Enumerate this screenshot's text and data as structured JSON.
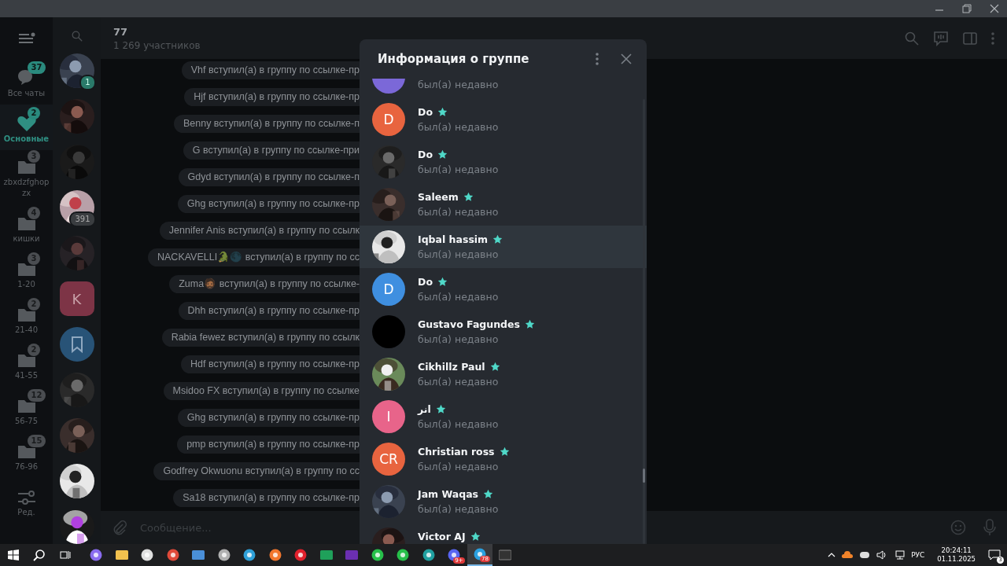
{
  "folders": [
    {
      "kind": "chats",
      "label": "Все чаты",
      "badge": "37",
      "selected": false
    },
    {
      "kind": "heart",
      "label": "Основные",
      "badge": "2",
      "selected": true
    },
    {
      "kind": "folder",
      "label": "zbxdzfghopzx",
      "badge": "3",
      "selected": false
    },
    {
      "kind": "folder",
      "label": "кишки",
      "badge": "4",
      "selected": false
    },
    {
      "kind": "folder",
      "label": "1-20",
      "badge": "3",
      "selected": false
    },
    {
      "kind": "folder",
      "label": "21-40",
      "badge": "2",
      "selected": false
    },
    {
      "kind": "folder",
      "label": "41-55",
      "badge": "2",
      "selected": false
    },
    {
      "kind": "folder",
      "label": "56-75",
      "badge": "12",
      "selected": false
    },
    {
      "kind": "folder",
      "label": "76-96",
      "badge": "15",
      "selected": false
    },
    {
      "kind": "edit",
      "label": "Ред.",
      "selected": false
    }
  ],
  "chat_list": [
    {
      "kind": "picture",
      "badge": "1",
      "badge_muted": false
    },
    {
      "kind": "picture"
    },
    {
      "kind": "picture"
    },
    {
      "kind": "picture",
      "badge": "391",
      "badge_muted": true
    },
    {
      "kind": "picture"
    },
    {
      "kind": "letter",
      "initials": "K",
      "color": "#7d3446"
    },
    {
      "kind": "bookmark",
      "color": "#285377"
    },
    {
      "kind": "picture"
    },
    {
      "kind": "picture"
    },
    {
      "kind": "picture"
    },
    {
      "kind": "picture"
    }
  ],
  "chat": {
    "title": "77",
    "subtitle": "1 269 участников",
    "messages": [
      "Vhf вступил(а) в группу по ссылке-пр",
      "Hjf вступил(а) в группу по ссылке-пр",
      "Benny вступил(а) в группу по ссылке-п",
      "G вступил(а) в группу по ссылке-при",
      "Gdyd вступил(а) в группу по ссылке-п",
      "Ghg вступил(а) в группу по ссылке-пр",
      "Jennifer Anis вступил(а) в группу по ссылк",
      "NACKAVELLI🐊🌑 вступил(а) в группу по сс",
      "Zuma🧔🏾 вступил(а) в группу по ссылке-",
      "Dhh вступил(а) в группу по ссылке-пр",
      "Rabia fewez вступил(а) в группу по ссылк",
      "Hdf вступил(а) в группу по ссылке-пр",
      "Msidoo FX вступил(а) в группу по ссылке",
      "Ghg вступил(а) в группу по ссылке-пр",
      "pmp вступил(а) в группу по ссылке-пр",
      "Godfrey Okwuonu вступил(а) в группу по сс",
      "Sa18 вступил(а) в группу по ссылке-пр"
    ],
    "input_placeholder": "Сообщение..."
  },
  "group_info": {
    "title": "Информация о группе",
    "members": [
      {
        "avatar": {
          "kind": "letter",
          "color": "#7b68d8"
        },
        "status": "был(а) недавно",
        "hovered": false
      },
      {
        "avatar": {
          "kind": "letter",
          "initials": "D",
          "color": "#e8643f"
        },
        "name": "Do",
        "admin": true,
        "status": "был(а) недавно",
        "hovered": false
      },
      {
        "avatar": {
          "kind": "picture"
        },
        "name": "Do",
        "admin": true,
        "status": "был(а) недавно",
        "hovered": false
      },
      {
        "avatar": {
          "kind": "picture"
        },
        "name": "Saleem",
        "admin": true,
        "status": "был(а) недавно",
        "hovered": false
      },
      {
        "avatar": {
          "kind": "picture"
        },
        "name": "Iqbal hassim",
        "admin": true,
        "status": "был(а) недавно",
        "hovered": true
      },
      {
        "avatar": {
          "kind": "letter",
          "initials": "D",
          "color": "#3f8fe0"
        },
        "name": "Do",
        "admin": true,
        "status": "был(а) недавно",
        "hovered": false
      },
      {
        "avatar": {
          "kind": "plain",
          "color": "#000000"
        },
        "name": "Gustavo Fagundes",
        "admin": true,
        "status": "был(а) недавно",
        "hovered": false
      },
      {
        "avatar": {
          "kind": "picture"
        },
        "name": "Cikhillz Paul",
        "admin": true,
        "status": "был(а) недавно",
        "hovered": false
      },
      {
        "avatar": {
          "kind": "letter",
          "initials": "I",
          "color": "#e8648a"
        },
        "name": "انر",
        "admin": true,
        "status": "был(а) недавно",
        "hovered": false
      },
      {
        "avatar": {
          "kind": "letter",
          "initials": "CR",
          "color": "#e8643f"
        },
        "name": "Christian ross",
        "admin": true,
        "status": "был(а) недавно",
        "hovered": false
      },
      {
        "avatar": {
          "kind": "picture"
        },
        "name": "Jam Waqas",
        "admin": true,
        "status": "был(а) недавно",
        "hovered": false
      },
      {
        "avatar": {
          "kind": "picture"
        },
        "name": "Victor AJ",
        "admin": true,
        "hovered": false
      }
    ]
  },
  "taskbar": {
    "apps": [
      {
        "kind": "gamepad"
      },
      {
        "kind": "explorer"
      },
      {
        "kind": "skull"
      },
      {
        "kind": "chrome"
      },
      {
        "kind": "window"
      },
      {
        "kind": "leaf"
      },
      {
        "kind": "edge"
      },
      {
        "kind": "firefox"
      },
      {
        "kind": "opera"
      },
      {
        "kind": "loop"
      },
      {
        "kind": "yahoo"
      },
      {
        "kind": "whatsapp"
      },
      {
        "kind": "whatsapp"
      },
      {
        "kind": "wave"
      },
      {
        "kind": "discord",
        "badge": "9+"
      },
      {
        "kind": "telegram",
        "badge": "78",
        "active": true
      },
      {
        "kind": "terminal"
      }
    ],
    "language": "РУС",
    "time": "20:24:11",
    "date": "01.11.2025",
    "notifications": "3"
  }
}
